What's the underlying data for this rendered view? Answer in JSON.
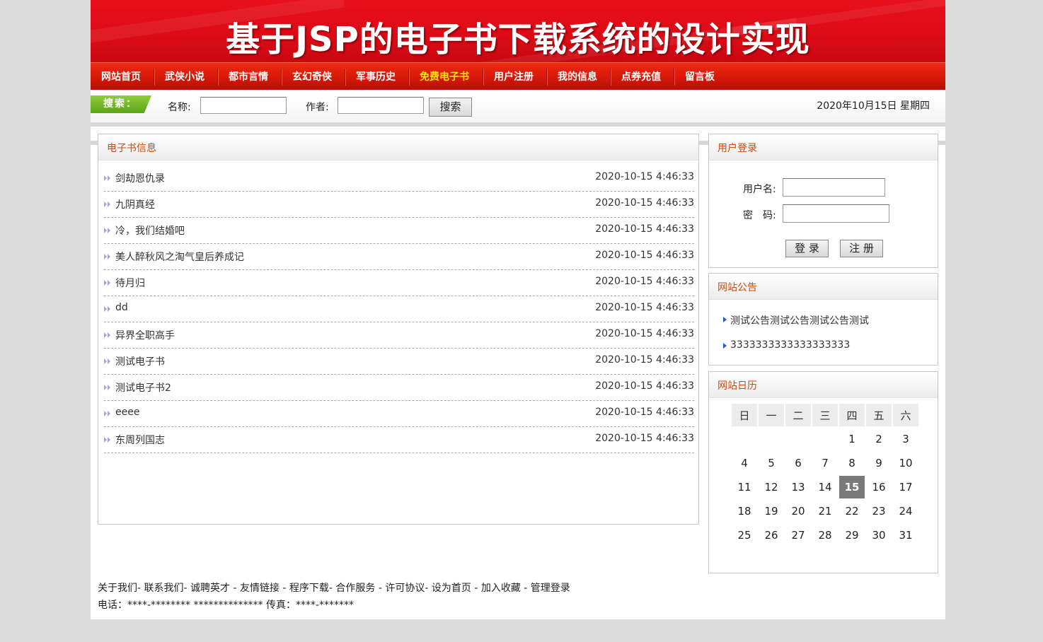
{
  "banner": {
    "title": "基于JSP的电子书下载系统的设计实现"
  },
  "nav": {
    "items": [
      {
        "label": "网站首页"
      },
      {
        "label": "武侠小说"
      },
      {
        "label": "都市言情"
      },
      {
        "label": "玄幻奇侠"
      },
      {
        "label": "军事历史"
      },
      {
        "label": "免费电子书"
      },
      {
        "label": "用户注册"
      },
      {
        "label": "我的信息"
      },
      {
        "label": "点券充值"
      },
      {
        "label": "留言板"
      }
    ],
    "active_color": "#ffea00"
  },
  "search": {
    "tag": "搜索：",
    "name_label": "名称:",
    "name_value": "",
    "author_label": "作者:",
    "author_value": "",
    "button": "搜索",
    "date": "2020年10月15日 星期四"
  },
  "books": {
    "title": "电子书信息",
    "items": [
      {
        "title": "剑劫恩仇录",
        "time": "2020-10-15 4:46:33"
      },
      {
        "title": "九阴真经",
        "time": "2020-10-15 4:46:33"
      },
      {
        "title": "冷，我们结婚吧",
        "time": "2020-10-15 4:46:33"
      },
      {
        "title": "美人醉秋风之淘气皇后养成记",
        "time": "2020-10-15 4:46:33"
      },
      {
        "title": "待月归",
        "time": "2020-10-15 4:46:33"
      },
      {
        "title": "dd",
        "time": "2020-10-15 4:46:33"
      },
      {
        "title": "异界全职高手",
        "time": "2020-10-15 4:46:33"
      },
      {
        "title": "测试电子书",
        "time": "2020-10-15 4:46:33"
      },
      {
        "title": "测试电子书2",
        "time": "2020-10-15 4:46:33"
      },
      {
        "title": "eeee",
        "time": "2020-10-15 4:46:33"
      },
      {
        "title": "东周列国志",
        "time": "2020-10-15 4:46:33"
      }
    ]
  },
  "login": {
    "title": "用户登录",
    "username_label": "用户名:",
    "username_value": "",
    "password_label": "密　码:",
    "password_value": "",
    "login_button": "登 录",
    "register_button": "注 册"
  },
  "notices": {
    "title": "网站公告",
    "items": [
      "测试公告测试公告测试公告测试",
      "3333333333333333333"
    ]
  },
  "calendar": {
    "title": "网站日历",
    "weekdays": [
      "日",
      "一",
      "二",
      "三",
      "四",
      "五",
      "六"
    ],
    "weeks": [
      [
        "",
        "",
        "",
        "",
        "1",
        "2",
        "3"
      ],
      [
        "4",
        "5",
        "6",
        "7",
        "8",
        "9",
        "10"
      ],
      [
        "11",
        "12",
        "13",
        "14",
        "15",
        "16",
        "17"
      ],
      [
        "18",
        "19",
        "20",
        "21",
        "22",
        "23",
        "24"
      ],
      [
        "25",
        "26",
        "27",
        "28",
        "29",
        "30",
        "31"
      ]
    ],
    "today": "15"
  },
  "footer": {
    "links": "关于我们- 联系我们- 诚聘英才 - 友情链接 - 程序下载- 合作服务 - 许可协议- 设为首页 - 加入收藏 - 管理登录",
    "contact": "电话：****-******** ************** 传真：****-*******"
  }
}
